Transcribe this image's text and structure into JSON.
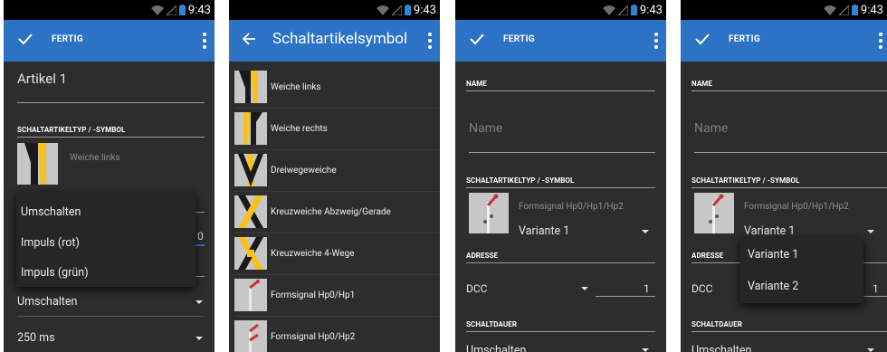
{
  "status_bar": {
    "time": "9:43"
  },
  "screens": [
    {
      "appbar": {
        "done_label": "FERTIG"
      },
      "article_name": "Artikel 1",
      "symbol_section_label": "SCHALTARTIKELTYP / -SYMBOL",
      "symbol_name": "Weiche links",
      "popup_options": [
        "Umschalten",
        "Impuls (rot)",
        "Impuls (grün)"
      ],
      "behind_popup_value": "0",
      "mode_value": "Umschalten",
      "duration_value": "250 ms"
    },
    {
      "appbar": {
        "title": "Schaltartikelsymbol"
      },
      "items": [
        "Weiche links",
        "Weiche rechts",
        "Dreiwegeweiche",
        "Kreuzweiche Abzweig/Gerade",
        "Kreuzweiche 4-Wege",
        "Formsignal Hp0/Hp1",
        "Formsignal Hp0/Hp2"
      ]
    },
    {
      "appbar": {
        "done_label": "FERTIG"
      },
      "name_section_label": "NAME",
      "name_placeholder": "Name",
      "symbol_section_label": "SCHALTARTIKELTYP / -SYMBOL",
      "symbol_name": "Formsignal Hp0/Hp1/Hp2",
      "variant_value": "Variante 1",
      "address_section_label": "ADRESSE",
      "protocol_value": "DCC",
      "address_value": "1",
      "duration_section_label": "SCHALTDAUER",
      "mode_value_partial": "Umschalten"
    },
    {
      "appbar": {
        "done_label": "FERTIG"
      },
      "name_section_label": "NAME",
      "name_placeholder": "Name",
      "symbol_section_label": "SCHALTARTIKELTYP / -SYMBOL",
      "symbol_name": "Formsignal Hp0/Hp1/Hp2",
      "variant_value": "Variante 1",
      "address_section_label": "ADRESSE",
      "protocol_value": "DCC",
      "address_value": "1",
      "duration_section_label": "SCHALTDAUER",
      "mode_value_partial": "Umschalten",
      "variant_options": [
        "Variante 1",
        "Variante 2"
      ]
    }
  ],
  "colors": {
    "appbar": "#2c72c5",
    "background": "#2d2d2d",
    "symbol_yellow": "#f6c21b",
    "signal_red": "#c8323c"
  }
}
